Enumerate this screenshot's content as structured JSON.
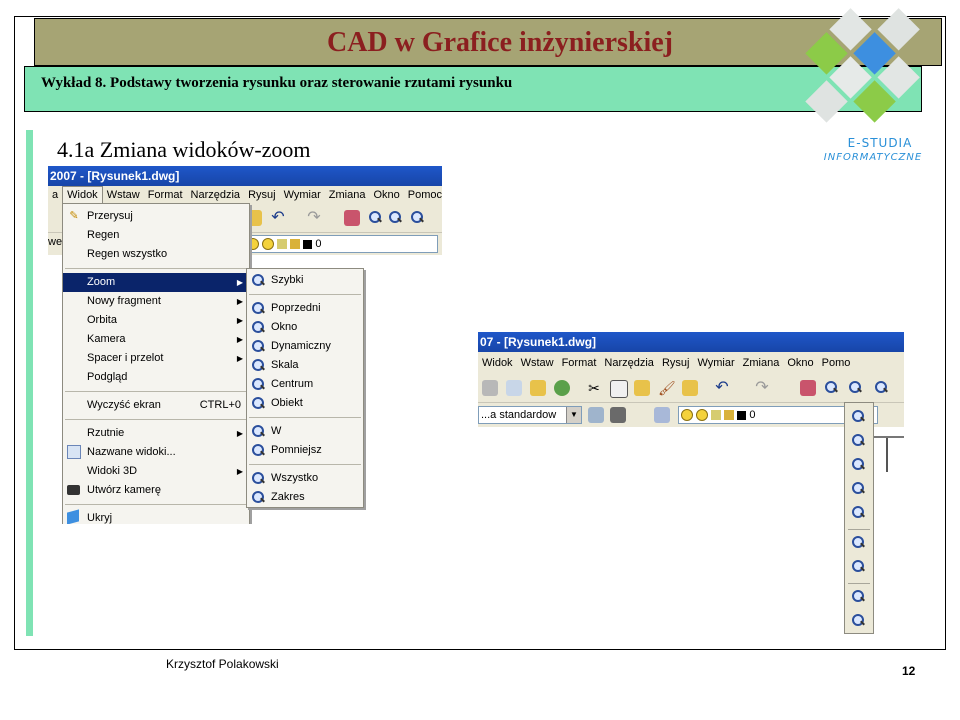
{
  "header": {
    "title": "CAD w Grafice inżynierskiej",
    "subtitle": "Wykład 8.  Podstawy tworzenia rysunku oraz sterowanie rzutami rysunku"
  },
  "section": {
    "title": "4.1a Zmiana widoków-zoom"
  },
  "logo": {
    "line1": "E-STUDIA",
    "line2": "INFORMATYCZNE"
  },
  "footer": {
    "author": "Krzysztof Polakowski",
    "page": "12"
  },
  "screenshot1": {
    "window_title": "2007 - [Rysunek1.dwg]",
    "menubar": [
      "a",
      "Widok",
      "Wstaw",
      "Format",
      "Narzędzia",
      "Rysuj",
      "Wymiar",
      "Zmiana",
      "Okno",
      "Pomoc"
    ],
    "layer_text": "we",
    "layer_value": "0",
    "widok_menu": [
      {
        "label": "Przerysuj"
      },
      {
        "label": "Regen"
      },
      {
        "label": "Regen wszystko"
      },
      {
        "label": "Zoom"
      },
      {
        "label": "Nowy fragment"
      },
      {
        "label": "Orbita"
      },
      {
        "label": "Kamera"
      },
      {
        "label": "Spacer i przelot"
      },
      {
        "label": "Podgląd"
      },
      {
        "label": "Wyczyść ekran",
        "shortcut": "CTRL+0"
      },
      {
        "label": "Rzutnie"
      },
      {
        "label": "Nazwane widoki..."
      },
      {
        "label": "Widoki 3D"
      },
      {
        "label": "Utwórz kamerę"
      },
      {
        "label": "Ukryj"
      }
    ],
    "zoom_submenu": [
      {
        "label": "Szybki"
      },
      {
        "label": "Poprzedni"
      },
      {
        "label": "Okno"
      },
      {
        "label": "Dynamiczny"
      },
      {
        "label": "Skala"
      },
      {
        "label": "Centrum"
      },
      {
        "label": "Obiekt"
      },
      {
        "label": "W"
      },
      {
        "label": "Pomniejsz"
      },
      {
        "label": "Wszystko"
      },
      {
        "label": "Zakres"
      }
    ]
  },
  "screenshot2": {
    "window_title": "07 - [Rysunek1.dwg]",
    "menubar": [
      "Widok",
      "Wstaw",
      "Format",
      "Narzędzia",
      "Rysuj",
      "Wymiar",
      "Zmiana",
      "Okno",
      "Pomo"
    ],
    "style_combo": "...a standardow",
    "layer_value": "0"
  },
  "colors": {
    "title_bar": "#a6a474",
    "title_text": "#8b1f1f",
    "subtitle_bar": "#7fe3b4",
    "menu_highlight": "#0a246a",
    "xp_title": "#1f57c9"
  }
}
